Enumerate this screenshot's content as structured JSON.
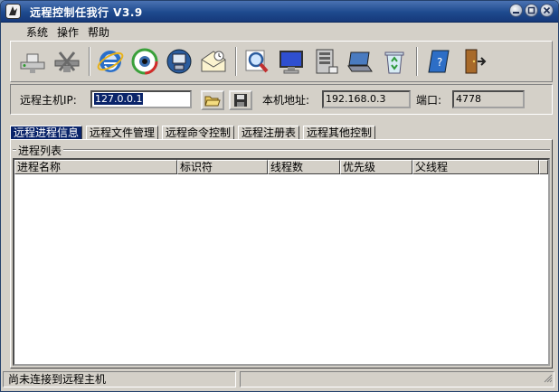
{
  "window": {
    "title": "远程控制任我行 V3.9"
  },
  "menu": [
    "系统",
    "操作",
    "帮助"
  ],
  "toolbar": {
    "icons": [
      "network-connect-icon",
      "network-disconnect-icon",
      "internet-explorer-icon",
      "eye-monitor-icon",
      "remote-computer-icon",
      "message-envelope-icon",
      "search-magnifier-icon",
      "screen-monitor-icon",
      "server-icon",
      "laptop-icon",
      "recycle-bin-icon",
      "help-book-icon",
      "exit-door-icon"
    ]
  },
  "connection": {
    "host_label": "远程主机IP:",
    "host_value": "127.0.0.1",
    "local_label": "本机地址:",
    "local_value": "192.168.0.3",
    "port_label": "端口:",
    "port_value": "4778"
  },
  "tabs": [
    "远程进程信息",
    "远程文件管理",
    "远程命令控制",
    "远程注册表",
    "远程其他控制"
  ],
  "process_group": {
    "legend": "进程列表",
    "columns": [
      "进程名称",
      "标识符",
      "线程数",
      "优先级",
      "父线程"
    ]
  },
  "status": {
    "message": "尚未连接到远程主机"
  },
  "colors": {
    "titlebar": "#1e4a8e",
    "active_tab": "#0a246a",
    "window_bg": "#d4d0c8"
  }
}
